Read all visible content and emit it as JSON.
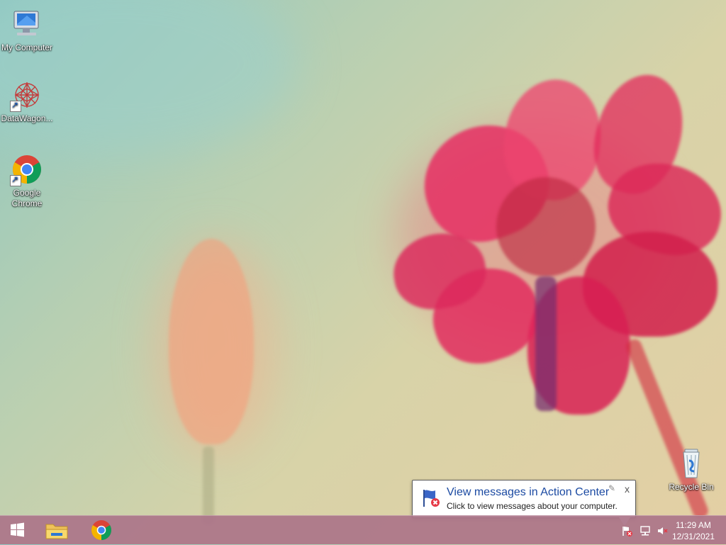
{
  "desktop": {
    "icons": [
      {
        "label": "My Computer"
      },
      {
        "label": "DataWagon..."
      },
      {
        "label": "Google Chrome"
      },
      {
        "label": "Recycle Bin"
      }
    ]
  },
  "notification": {
    "title": "View messages in Action Center",
    "body": "Click to view messages about your computer.",
    "close": "x",
    "settings_icon": "wrench-icon"
  },
  "taskbar": {
    "apps": [
      {
        "name": "start-button",
        "icon": "windows-logo-icon"
      },
      {
        "name": "file-explorer",
        "icon": "folder-icon"
      },
      {
        "name": "google-chrome",
        "icon": "chrome-icon"
      }
    ],
    "tray": {
      "time": "11:29 AM",
      "date": "12/31/2021",
      "icons": [
        "action-center-flag-icon",
        "network-icon",
        "volume-muted-icon"
      ]
    }
  }
}
